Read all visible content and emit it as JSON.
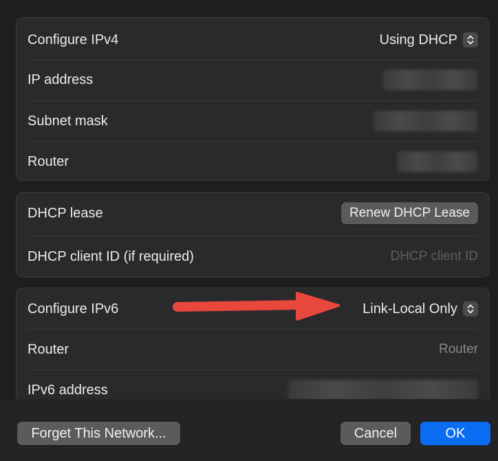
{
  "ipv4": {
    "configure_label": "Configure IPv4",
    "configure_value": "Using DHCP",
    "ip_label": "IP address",
    "subnet_label": "Subnet mask",
    "router_label": "Router"
  },
  "dhcp": {
    "lease_label": "DHCP lease",
    "renew_button": "Renew DHCP Lease",
    "client_id_label": "DHCP client ID (if required)",
    "client_id_placeholder": "DHCP client ID"
  },
  "ipv6": {
    "configure_label": "Configure IPv6",
    "configure_value": "Link-Local Only",
    "router_label": "Router",
    "router_placeholder": "Router",
    "address_label": "IPv6 address"
  },
  "footer": {
    "forget_button": "Forget This Network...",
    "cancel_button": "Cancel",
    "ok_button": "OK"
  },
  "colors": {
    "accent": "#0a6cf0",
    "arrow": "#e8473c"
  },
  "icons": {
    "stepper": "chevron-up-down-icon",
    "annotation": "red-arrow-icon"
  }
}
